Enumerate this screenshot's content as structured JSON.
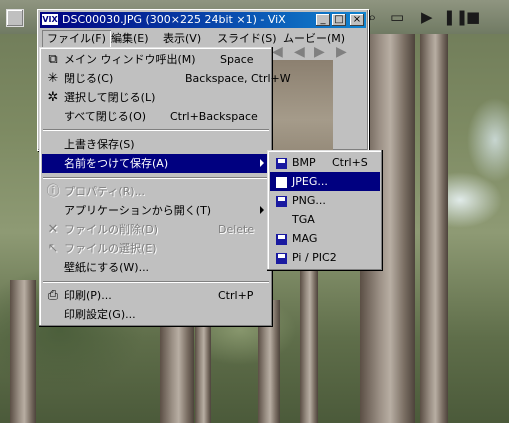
{
  "window": {
    "title": "DSC00030.JPG (300×225 24bit ×1) - ViX",
    "app_icon_text": "VIX",
    "minimize": "_",
    "maximize": "□",
    "close": "×"
  },
  "menubar": [
    "ファイル(F)",
    "編集(E)",
    "表示(V)",
    "スライド(S)",
    "ムービー(M)"
  ],
  "file_menu": {
    "items": [
      {
        "label": "メイン ウィンドウ呼出(M)",
        "shortcut": "Space",
        "icon": "main-window-icon"
      },
      {
        "label": "閉じる(C)",
        "shortcut": "Backspace, Ctrl+W",
        "icon": "close-burst-icon"
      },
      {
        "label": "選択して閉じる(L)",
        "shortcut": "",
        "icon": "select-close-icon"
      },
      {
        "label": "すべて閉じる(O)",
        "shortcut": "Ctrl+Backspace",
        "icon": ""
      },
      {
        "label": "上書き保存(S)",
        "shortcut": "",
        "icon": ""
      },
      {
        "label": "名前をつけて保存(A)",
        "shortcut": "",
        "icon": ""
      },
      {
        "label": "プロパティ(R)...",
        "shortcut": "",
        "icon": "info-icon"
      },
      {
        "label": "アプリケーションから開く(T)",
        "shortcut": "",
        "icon": ""
      },
      {
        "label": "ファイルの削除(D)",
        "shortcut": "Delete",
        "icon": "delete-x-icon"
      },
      {
        "label": "ファイルの選択(E)",
        "shortcut": "",
        "icon": "cursor-icon"
      },
      {
        "label": "壁紙にする(W)...",
        "shortcut": "",
        "icon": ""
      },
      {
        "label": "印刷(P)...",
        "shortcut": "Ctrl+P",
        "icon": "printer-icon"
      },
      {
        "label": "印刷設定(G)...",
        "shortcut": "",
        "icon": ""
      }
    ]
  },
  "save_as_menu": {
    "items": [
      {
        "label": "BMP",
        "shortcut": "Ctrl+S",
        "icon": "floppy-icon"
      },
      {
        "label": "JPEG...",
        "shortcut": "",
        "icon": "floppy-icon"
      },
      {
        "label": "PNG...",
        "shortcut": "",
        "icon": "floppy-icon"
      },
      {
        "label": "TGA",
        "shortcut": "",
        "icon": ""
      },
      {
        "label": "MAG",
        "shortcut": "",
        "icon": "floppy-icon"
      },
      {
        "label": "Pi / PIC2",
        "shortcut": "",
        "icon": "floppy-icon"
      }
    ]
  },
  "colors": {
    "highlight": "#000080",
    "menu_bg": "#c0c0c0",
    "title_start": "#000080",
    "title_end": "#1084d0"
  }
}
